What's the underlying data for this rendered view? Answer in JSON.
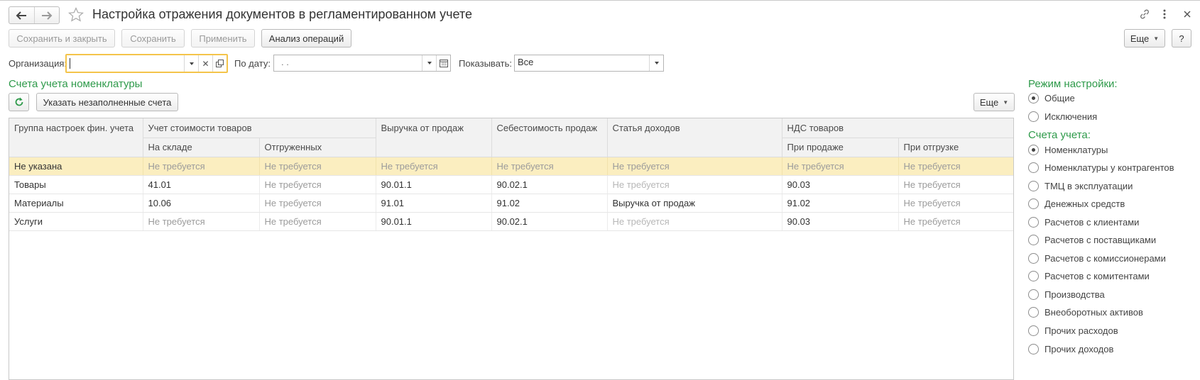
{
  "window": {
    "title": "Настройка отражения документов в регламентированном учете"
  },
  "toolbar": {
    "save_close": "Сохранить и закрыть",
    "save": "Сохранить",
    "apply": "Применить",
    "analyze": "Анализ операций",
    "more": "Еще",
    "help": "?"
  },
  "filters": {
    "org_label": "Организация:",
    "org_value": "",
    "date_label": "По дату:",
    "date_value": ". .",
    "show_label": "Показывать:",
    "show_value": "Все"
  },
  "section": {
    "title": "Счета учета номенклатуры",
    "fill_button": "Указать незаполненные счета",
    "more": "Еще"
  },
  "table": {
    "headers": {
      "group": "Группа настроек фин. учета",
      "cost": "Учет стоимости товаров",
      "cost_stock": "На складе",
      "cost_shipped": "Отгруженных",
      "revenue": "Выручка от продаж",
      "cogs": "Себестоимость продаж",
      "income": "Статья доходов",
      "vat": "НДС товаров",
      "vat_sale": "При продаже",
      "vat_ship": "При отгрузке"
    },
    "rows": [
      {
        "group": "Не указана",
        "stock": "Не требуется",
        "shipped": "Не требуется",
        "revenue": "Не требуется",
        "cogs": "Не требуется",
        "income": "Не требуется",
        "vat_sale": "Не требуется",
        "vat_ship": "Не требуется"
      },
      {
        "group": "Товары",
        "stock": "41.01",
        "shipped": "Не требуется",
        "revenue": "90.01.1",
        "cogs": "90.02.1",
        "income": "Не требуется",
        "vat_sale": "90.03",
        "vat_ship": "Не требуется"
      },
      {
        "group": "Материалы",
        "stock": "10.06",
        "shipped": "Не требуется",
        "revenue": "91.01",
        "cogs": "91.02",
        "income": "Выручка от продаж",
        "vat_sale": "91.02",
        "vat_ship": "Не требуется"
      },
      {
        "group": "Услуги",
        "stock": "Не требуется",
        "shipped": "Не требуется",
        "revenue": "90.01.1",
        "cogs": "90.02.1",
        "income": "Не требуется",
        "vat_sale": "90.03",
        "vat_ship": "Не требуется"
      }
    ]
  },
  "settings_mode": {
    "title": "Режим настройки:",
    "options": [
      "Общие",
      "Исключения"
    ],
    "selected": 0
  },
  "accounts": {
    "title": "Счета учета:",
    "options": [
      "Номенклатуры",
      "Номенклатуры у контрагентов",
      "ТМЦ в эксплуатации",
      "Денежных средств",
      "Расчетов с клиентами",
      "Расчетов с поставщиками",
      "Расчетов с комиссионерами",
      "Расчетов с комитентами",
      "Производства",
      "Внеоборотных активов",
      "Прочих расходов",
      "Прочих доходов"
    ],
    "selected": 0
  },
  "colors": {
    "accent_green": "#2e9a4a",
    "selection": "#fbeec0",
    "focus": "#f4c44a"
  }
}
